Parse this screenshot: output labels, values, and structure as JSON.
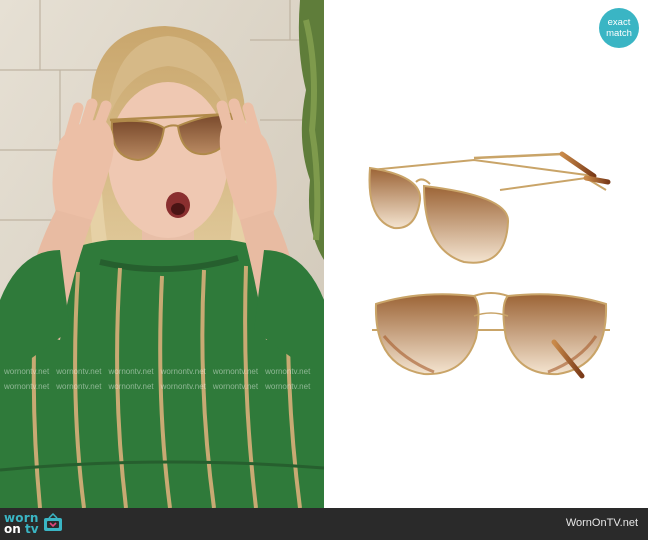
{
  "badge": {
    "line1": "exact",
    "line2": "match"
  },
  "footer": {
    "logo_line1": "worn",
    "logo_line2_a": "on",
    "logo_line2_b": "tv",
    "site": "WornOnTV.net"
  },
  "watermark": {
    "text": "wornontv.net"
  },
  "colors": {
    "accent": "#3ab5c4",
    "footer_bg": "#2a2a2a",
    "dress_green": "#2f7a3a",
    "stripe": "#d9b07a",
    "lens_brown": "#a86a3c",
    "frame_gold": "#c9a468"
  }
}
